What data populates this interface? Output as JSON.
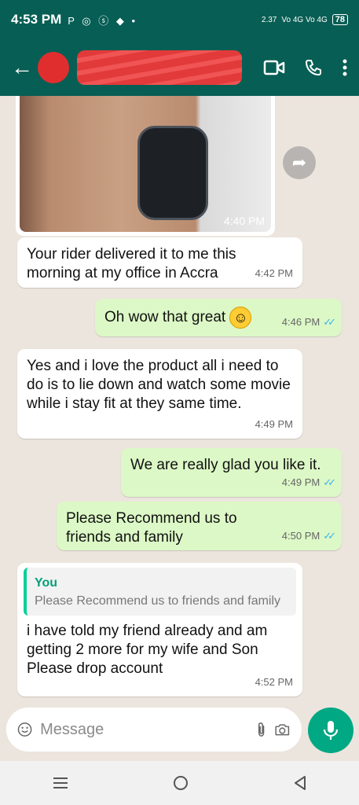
{
  "status_bar": {
    "time": "4:53 PM",
    "icons": "P ◎ ⓢ ◆ •",
    "speed": "2.37",
    "network": "Vo 4G Vo 4G",
    "battery": "78"
  },
  "app_bar": {
    "contact_name": "",
    "icons": [
      "back-arrow-icon",
      "video-call-icon",
      "phone-icon",
      "more-options-icon"
    ]
  },
  "colors": {
    "header": "#075e54",
    "incoming_bubble": "#ffffff",
    "outgoing_bubble": "#dcf8c6",
    "read_ticks": "#34b7f1",
    "mic_button": "#00a884",
    "chat_background": "#ece5dd"
  },
  "messages": {
    "image": {
      "time": "4:40 PM"
    },
    "m1": {
      "text": "Your rider delivered it to me this morning at my office in Accra",
      "time": "4:42 PM"
    },
    "m2": {
      "text": "Oh wow that great",
      "emoji": "☺",
      "time": "4:46 PM"
    },
    "m3": {
      "text": "Yes and i love the product all i need to do is to lie down and watch some movie while i stay fit at they same time.",
      "time": "4:49 PM"
    },
    "m4": {
      "text": "We are really glad you like it.",
      "time": "4:49 PM"
    },
    "m5": {
      "text": "Please Recommend us to friends and family",
      "time": "4:50 PM"
    },
    "m6": {
      "quote_author": "You",
      "quote_text": "Please Recommend us to friends and family",
      "text": "i have told my friend already and am getting 2 more for my wife and Son Please drop account",
      "time": "4:52 PM"
    }
  },
  "input": {
    "placeholder": "Message"
  },
  "nav_bar": {
    "icons": [
      "recent-apps-icon",
      "home-icon",
      "back-icon"
    ]
  }
}
